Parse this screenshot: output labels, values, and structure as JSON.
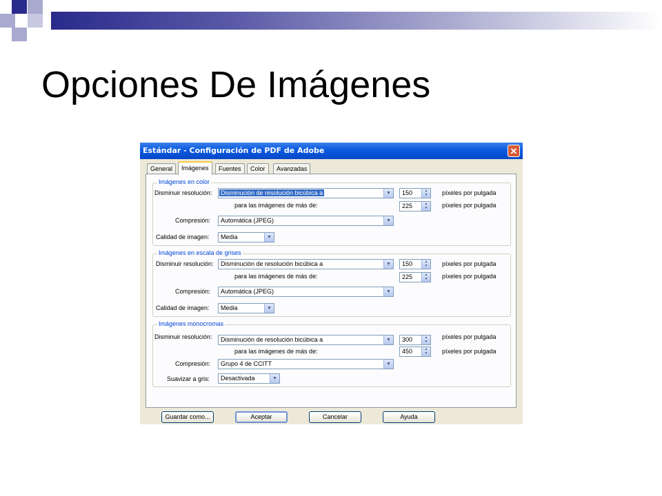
{
  "slide": {
    "title": "Opciones De Imágenes"
  },
  "dialog": {
    "title": "Estándar - Configuración de PDF de Adobe",
    "close_glyph": "✕",
    "tabs": [
      "General",
      "Imágenes",
      "Fuentes",
      "Color",
      "Avanzadas"
    ],
    "active_tab": "Imágenes",
    "groups": [
      {
        "title": "Imágenes en color",
        "downsample_label": "Disminuir resolución:",
        "downsample_value": "Disminución de resolución bicúbica a",
        "resolution": "150",
        "above_label": "para las imágenes de más de:",
        "above": "225",
        "unit": "píxeles por pulgada",
        "compression_label": "Compresión:",
        "compression_value": "Automática (JPEG)",
        "quality_label": "Calidad de imagen:",
        "quality_value": "Media"
      },
      {
        "title": "Imágenes en escala de grises",
        "downsample_label": "Disminuir resolución:",
        "downsample_value": "Disminución de resolución bicúbica a",
        "resolution": "150",
        "above_label": "para las imágenes de más de:",
        "above": "225",
        "unit": "píxeles por pulgada",
        "compression_label": "Compresión:",
        "compression_value": "Automática (JPEG)",
        "quality_label": "Calidad de imagen:",
        "quality_value": "Media"
      },
      {
        "title": "Imágenes monocromas",
        "downsample_label": "Disminuir resolución:",
        "downsample_value": "Disminución de resolución bicúbica a",
        "resolution": "300",
        "above_label": "para las imágenes de más de:",
        "above": "450",
        "unit": "píxeles por pulgada",
        "compression_label": "Compresión:",
        "compression_value": "Grupo 4 de CCITT",
        "smooth_label": "Suavizar a gris:",
        "smooth_value": "Desactivada"
      }
    ],
    "buttons": {
      "save": "Guardar como...",
      "ok": "Aceptar",
      "cancel": "Cancelar",
      "help": "Ayuda"
    }
  },
  "colors": {
    "accent_bar": "#2a2a8c",
    "title_bar": "#0a5ae0",
    "group_title": "#0046d5",
    "selection": "#316ac5"
  },
  "icons": {
    "dropdown": "chevron-down-icon",
    "spinner": "up-down-arrows-icon",
    "close": "close-icon"
  }
}
